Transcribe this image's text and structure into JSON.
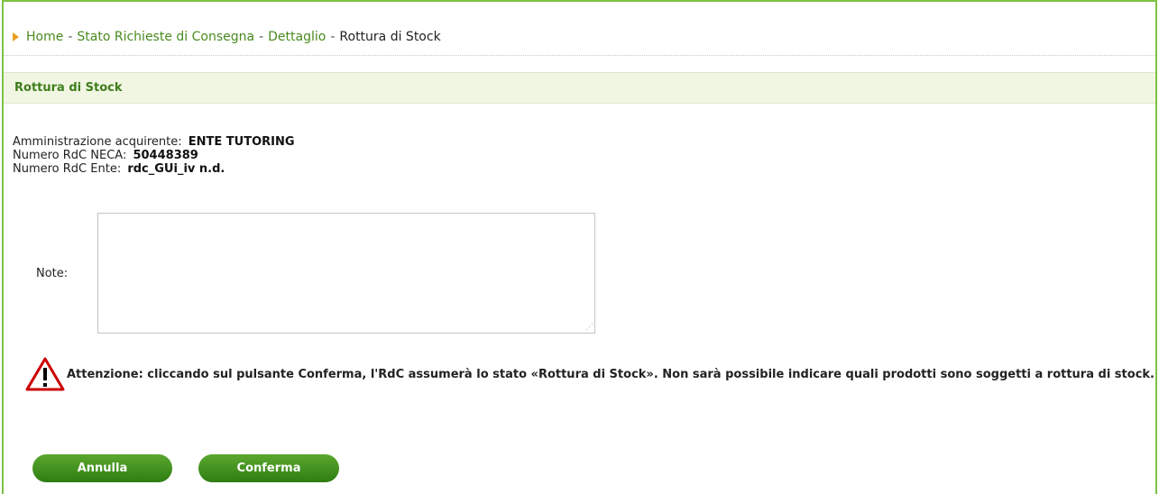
{
  "breadcrumb": {
    "items": [
      {
        "label": "Home"
      },
      {
        "label": "Stato Richieste di Consegna"
      },
      {
        "label": "Dettaglio"
      }
    ],
    "current": "Rottura di Stock",
    "separator": "-"
  },
  "section": {
    "title": "Rottura di Stock"
  },
  "info": {
    "amministrazione_label": "Amministrazione acquirente:",
    "amministrazione_value": "ENTE TUTORING",
    "rdc_neca_label": "Numero RdC NECA:",
    "rdc_neca_value": "50448389",
    "rdc_ente_label": "Numero RdC Ente:",
    "rdc_ente_value": "rdc_GUi_iv n.d."
  },
  "note": {
    "label": "Note:",
    "value": ""
  },
  "warning": {
    "icon": "warning-triangle-icon",
    "text": "Attenzione: cliccando sul pulsante Conferma, l'RdC assumerà lo stato «Rottura di Stock». Non sarà possibile indicare quali prodotti sono soggetti a rottura di stock."
  },
  "buttons": {
    "annulla": "Annulla",
    "conferma": "Conferma"
  },
  "colors": {
    "accent_green": "#7cc242",
    "link_green": "#4a8a1e",
    "button_green": "#3f8a1a",
    "header_bg": "#f1f6e3",
    "warning_red": "#cc0000",
    "breadcrumb_arrow": "#e8a020"
  }
}
